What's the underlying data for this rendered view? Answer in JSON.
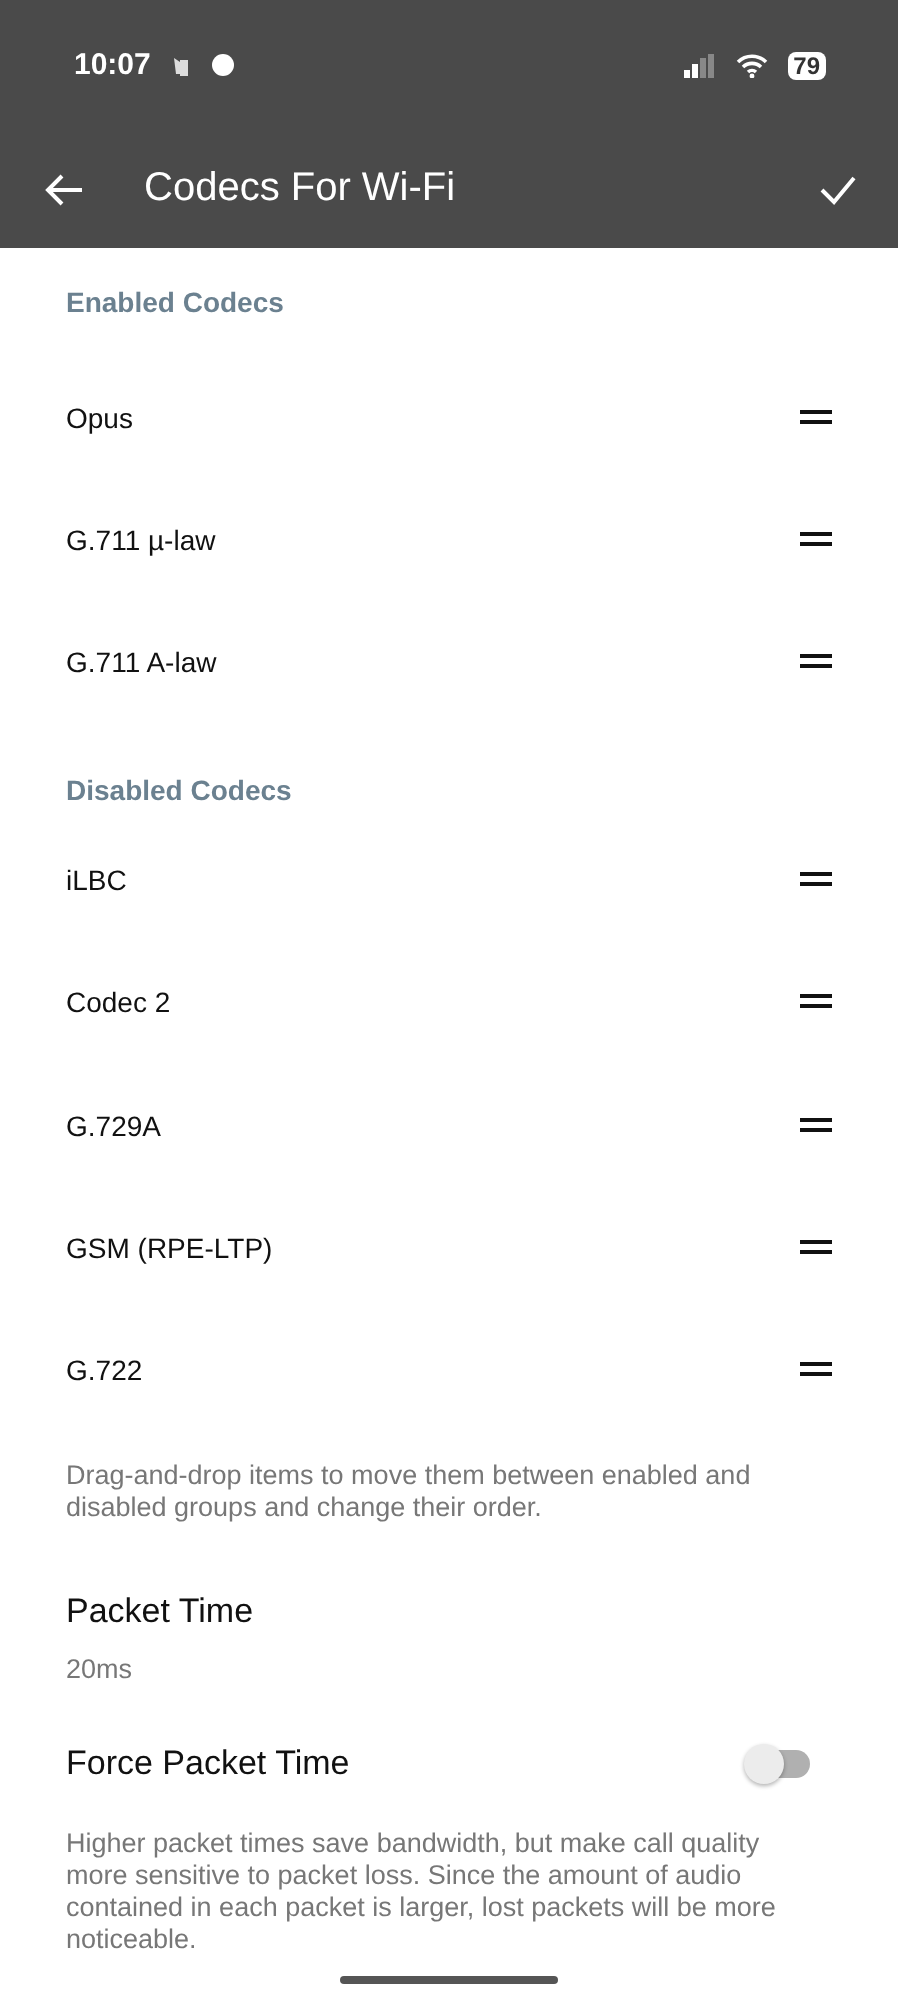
{
  "status_bar": {
    "time": "10:07",
    "battery": "79"
  },
  "app_bar": {
    "title": "Codecs For Wi-Fi"
  },
  "sections": [
    {
      "title": "Enabled Codecs",
      "items": [
        {
          "label": "Opus"
        },
        {
          "label": "G.711 µ-law"
        },
        {
          "label": "G.711 A-law"
        }
      ]
    },
    {
      "title": "Disabled Codecs",
      "items": [
        {
          "label": "iLBC"
        },
        {
          "label": "Codec 2"
        },
        {
          "label": "G.729A"
        },
        {
          "label": "GSM (RPE-LTP)"
        },
        {
          "label": "G.722"
        }
      ]
    }
  ],
  "hint": "Drag-and-drop items to move them between enabled and disabled groups and change their order.",
  "packet_time": {
    "title": "Packet Time",
    "value": "20ms"
  },
  "force_packet_time": {
    "title": "Force Packet Time",
    "on": false
  },
  "footer_note": "Higher packet times save bandwidth, but make call quality more sensitive to packet loss. Since the amount of audio contained in each packet is larger, lost packets will be more noticeable."
}
